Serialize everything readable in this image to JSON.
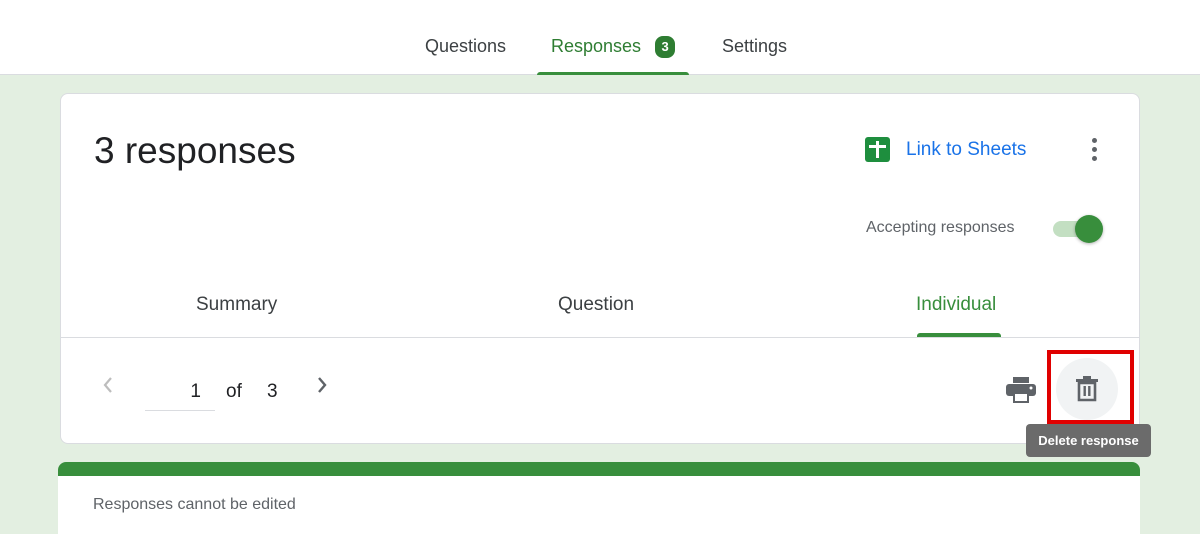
{
  "top_nav": {
    "tabs": [
      {
        "label": "Questions",
        "active": false
      },
      {
        "label": "Responses",
        "active": true,
        "badge": "3"
      },
      {
        "label": "Settings",
        "active": false
      }
    ]
  },
  "summary_card": {
    "title": "3 responses",
    "link_to_sheets_label": "Link to Sheets",
    "more_icon": "more-vert-icon",
    "accepting_label": "Accepting responses",
    "accepting_on": true,
    "sub_tabs": [
      {
        "label": "Summary",
        "active": false
      },
      {
        "label": "Question",
        "active": false
      },
      {
        "label": "Individual",
        "active": true
      }
    ],
    "pager": {
      "current": "1",
      "of_label": "of",
      "total": "3"
    },
    "print_icon": "print-icon",
    "delete_icon": "trash-icon",
    "tooltip": "Delete response"
  },
  "response_card": {
    "notice": "Responses cannot be edited"
  },
  "colors": {
    "accent": "#388e3c",
    "background": "#e3efe1",
    "link": "#1a73e8",
    "highlight": "#e00000"
  }
}
